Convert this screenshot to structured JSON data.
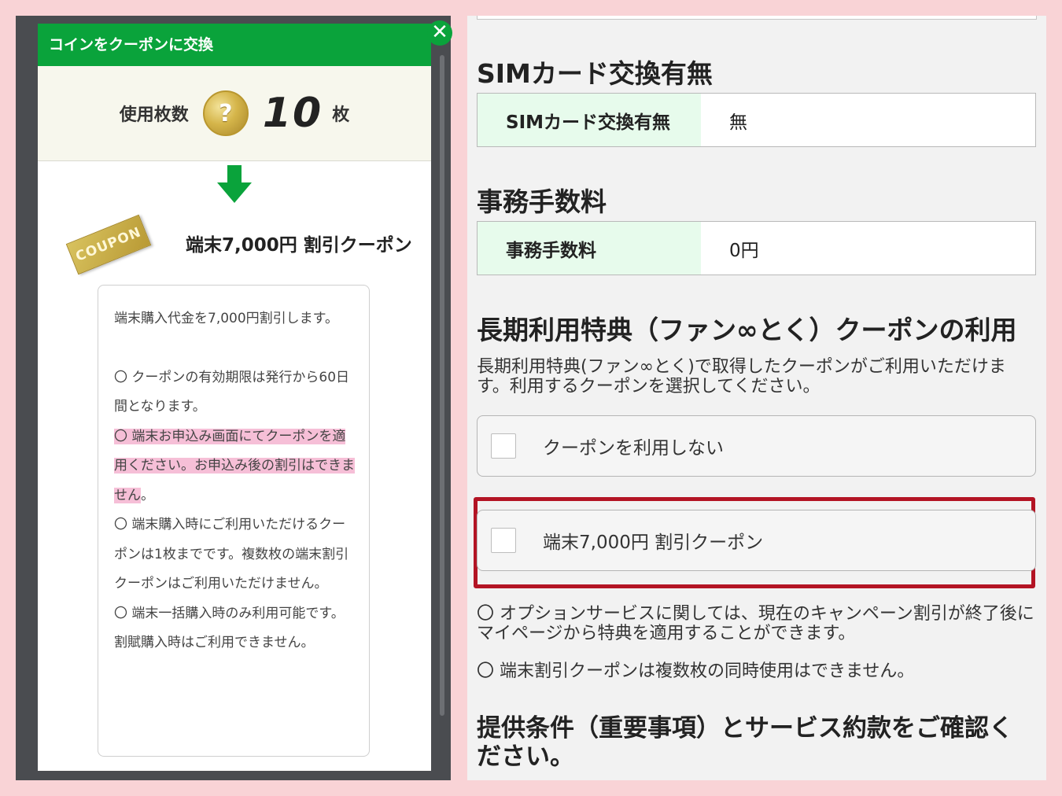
{
  "modal": {
    "header_title": "コインをクーポンに交換",
    "close_glyph": "✕",
    "coin_label": "使用枚数",
    "coin_glyph": "?",
    "coin_count": "10",
    "coin_unit": "枚",
    "coupon_badge": "COUPON",
    "coupon_title": "端末7,000円 割引クーポン",
    "desc": {
      "p1": "端末購入代金を7,000円割引します。",
      "item1": "〇 クーポンの有効期限は発行から60日間となります。",
      "item2_highlight": "〇 端末お申込み画面にてクーポンを適用ください。お申込み後の割引はできません",
      "item2_tail": "。",
      "item3": "〇 端末購入時にご利用いただけるクーポンは1枚までです。複数枚の端末割引クーポンはご利用いただけません。",
      "item4": "〇 端末一括購入時のみ利用可能です。割賦購入時はご利用できません。"
    }
  },
  "right": {
    "sim_section_title": "SIMカード交換有無",
    "sim_row_label": "SIMカード交換有無",
    "sim_row_value": "無",
    "fee_section_title": "事務手数料",
    "fee_row_label": "事務手数料",
    "fee_row_value": "0円",
    "coupon_section_title": "長期利用特典（ファン∞とく）クーポンの利用",
    "coupon_intro": "長期利用特典(ファン∞とく)で取得したクーポンがご利用いただけます。利用するクーポンを選択してください。",
    "options": [
      "クーポンを利用しない",
      "端末7,000円 割引クーポン"
    ],
    "note1": "〇 オプションサービスに関しては、現在のキャンペーン割引が終了後にマイページから特典を適用することができます。",
    "note2": "〇 端末割引クーポンは複数枚の同時使用はできません。",
    "final_title": "提供条件（重要事項）とサービス約款をご確認ください。"
  },
  "colors": {
    "brand_green": "#0aa33b",
    "highlight_pink": "#f6bfd7",
    "table_head_bg": "#e7fbec",
    "red_frame": "#b31424",
    "page_bg": "#f9d3d6"
  },
  "icons": [
    "close-icon",
    "coin-icon",
    "arrow-down-icon",
    "coupon-badge-icon",
    "checkbox-icon"
  ]
}
